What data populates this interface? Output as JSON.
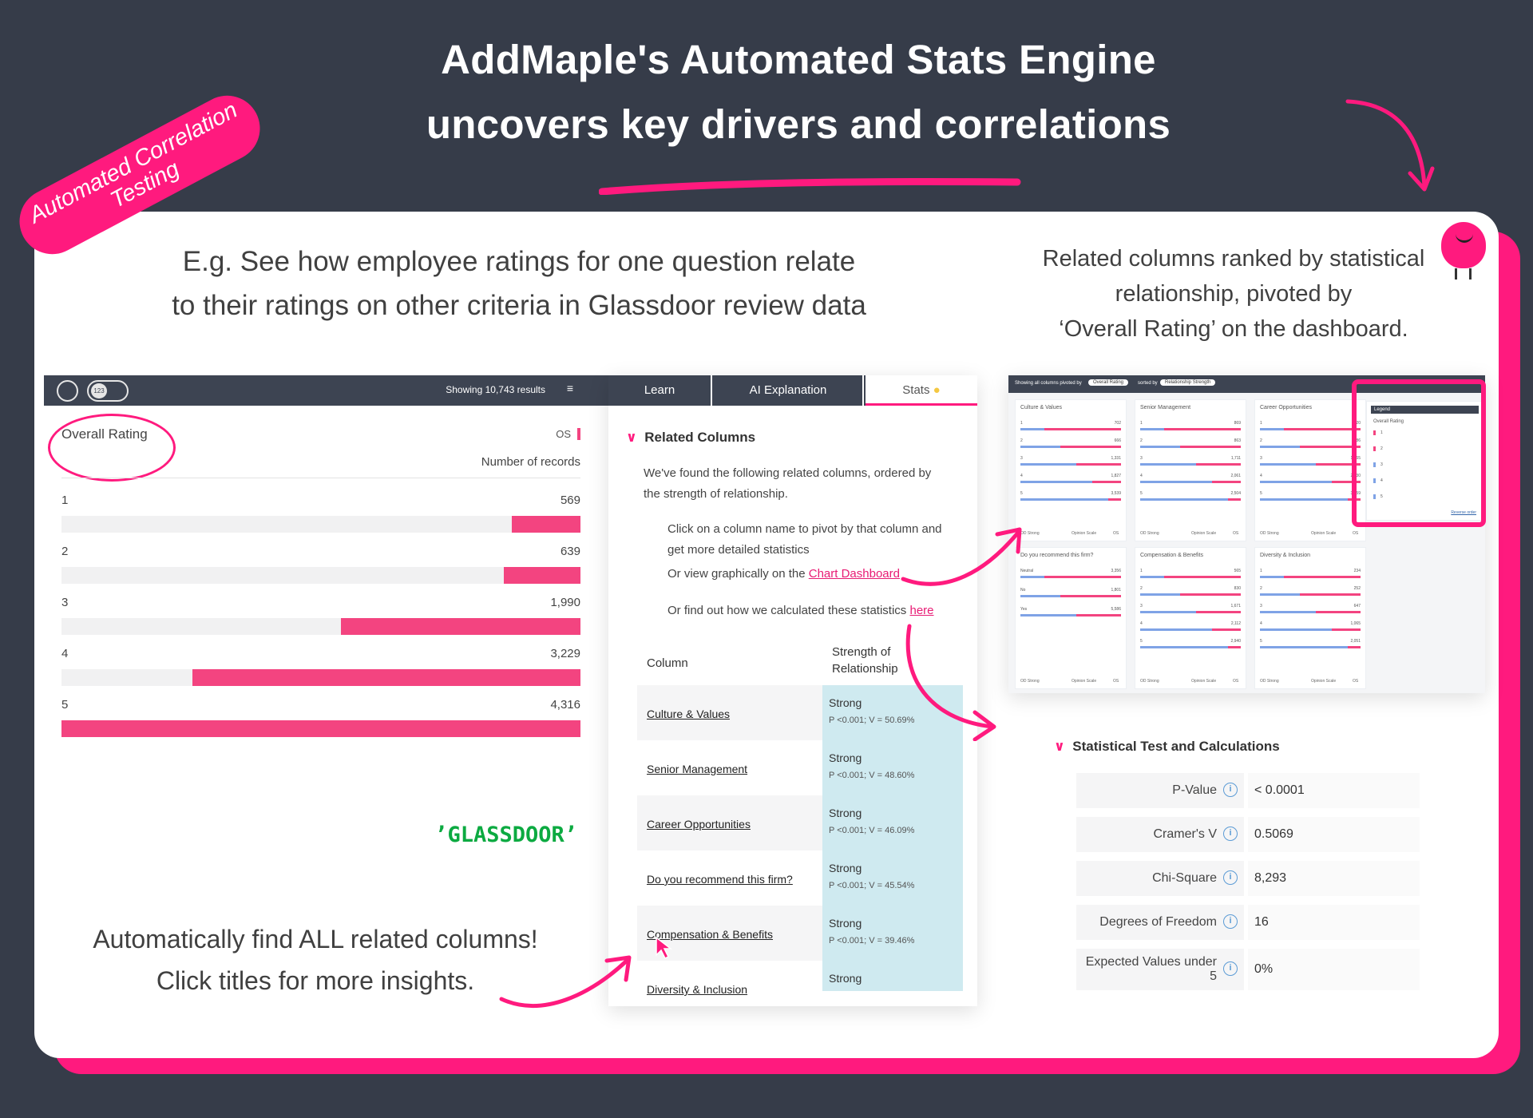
{
  "headline": {
    "line1": "AddMaple's Automated Stats Engine",
    "line2": "uncovers key drivers and correlations"
  },
  "sticker": {
    "line1": "Automated Correlation",
    "line2": "Testing"
  },
  "captions": {
    "left_top_1": "E.g. See how employee ratings for one question relate",
    "left_top_2": "to their ratings on other criteria in Glassdoor review data",
    "right_top_1": "Related columns ranked by statistical",
    "right_top_2": "relationship, pivoted by",
    "right_top_3": "‘Overall Rating’ on the dashboard.",
    "bottom_1": "Automatically find ALL related columns!",
    "bottom_2": "Click titles for more insights."
  },
  "chart_panel": {
    "results": "Showing 10,743 results",
    "toggle_num": "123",
    "title": "Overall Rating",
    "tag": "OS",
    "sub": "Number of records",
    "brand": "’GLASSDOORʼ",
    "chart_data": {
      "type": "bar",
      "title": "Overall Rating",
      "xlabel": "Number of records",
      "categories": [
        "1",
        "2",
        "3",
        "4",
        "5"
      ],
      "values": [
        569,
        639,
        1990,
        3229,
        4316
      ],
      "value_labels": [
        "569",
        "639",
        "1,990",
        "3,229",
        "4,316"
      ]
    }
  },
  "stats_panel": {
    "tabs": [
      "Learn",
      "AI Explanation",
      "Stats"
    ],
    "section": "Related Columns",
    "intro": "We've found the following related columns, ordered by the strength of relationship.",
    "bullet1": "Click on a column name to pivot by that column and get more detailed statistics",
    "bullet2_pre": "Or view graphically on the ",
    "bullet2_link": "Chart Dashboard",
    "bullet3_pre": "Or find out how we calculated these statistics ",
    "bullet3_link": "here",
    "col_header": "Column",
    "strength_header": "Strength of Relationship",
    "rows": [
      {
        "name": "Culture & Values",
        "strength": "Strong",
        "detail": "P <0.001; V = 50.69%"
      },
      {
        "name": "Senior Management",
        "strength": "Strong",
        "detail": "P <0.001; V = 48.60%"
      },
      {
        "name": "Career Opportunities",
        "strength": "Strong",
        "detail": "P <0.001; V = 46.09%"
      },
      {
        "name": "Do you recommend this firm?",
        "strength": "Strong",
        "detail": "P <0.001; V = 45.54%"
      },
      {
        "name": "Compensation & Benefits",
        "strength": "Strong",
        "detail": "P <0.001; V = 39.46%"
      },
      {
        "name": "Diversity & Inclusion",
        "strength": "Strong",
        "detail": ""
      }
    ]
  },
  "dashboard": {
    "toolbar_text": "Showing all columns pivoted by",
    "pivot": "Overall Rating",
    "sorted_by": "sorted by",
    "sort": "Relationship Strength",
    "legend_title": "Legend",
    "legend_sub": "Overall Rating",
    "legend_items": [
      "1",
      "2",
      "3",
      "4",
      "5"
    ],
    "legend_reverse": "Reverse order",
    "cards": [
      {
        "title": "Culture & Values",
        "rows": [
          "1",
          "2",
          "3",
          "4",
          "5"
        ],
        "vals": [
          "702",
          "666",
          "1,331",
          "1,827",
          "3,539"
        ]
      },
      {
        "title": "Senior Management",
        "rows": [
          "1",
          "2",
          "3",
          "4",
          "5"
        ],
        "vals": [
          "869",
          "863",
          "1,711",
          "2,061",
          "2,504"
        ]
      },
      {
        "title": "Career Opportunities",
        "rows": [
          "1",
          "2",
          "3",
          "4",
          "5"
        ],
        "vals": [
          "620",
          "686",
          "1,565",
          "2,030",
          "3,259"
        ]
      },
      {
        "title": "Do you recommend this firm?",
        "rows": [
          "Neutral",
          "No",
          "Yes"
        ],
        "vals": [
          "3,356",
          "1,801",
          "5,586"
        ]
      },
      {
        "title": "Compensation & Benefits",
        "rows": [
          "1",
          "2",
          "3",
          "4",
          "5"
        ],
        "vals": [
          "565",
          "830",
          "1,671",
          "2,112",
          "2,940"
        ]
      },
      {
        "title": "Diversity & Inclusion",
        "rows": [
          "1",
          "2",
          "3",
          "4",
          "5"
        ],
        "vals": [
          "234",
          "252",
          "647",
          "1,065",
          "2,051"
        ]
      }
    ],
    "card_foot_strong": "OD Strong",
    "card_foot_scale": "Opinion Scale",
    "card_foot_os": "OS"
  },
  "stat_test": {
    "title": "Statistical Test and Calculations",
    "rows": [
      {
        "k": "P-Value",
        "v": "< 0.0001"
      },
      {
        "k": "Cramer's V",
        "v": "0.5069"
      },
      {
        "k": "Chi-Square",
        "v": "8,293"
      },
      {
        "k": "Degrees of Freedom",
        "v": "16"
      },
      {
        "k": "Expected Values under 5",
        "v": "0%"
      }
    ]
  },
  "colors": {
    "accent": "#ff1a7e",
    "bar": "#f34480",
    "highlight": "#cfeaf0",
    "background": "#363c49",
    "glassdoor": "#0caa41"
  }
}
